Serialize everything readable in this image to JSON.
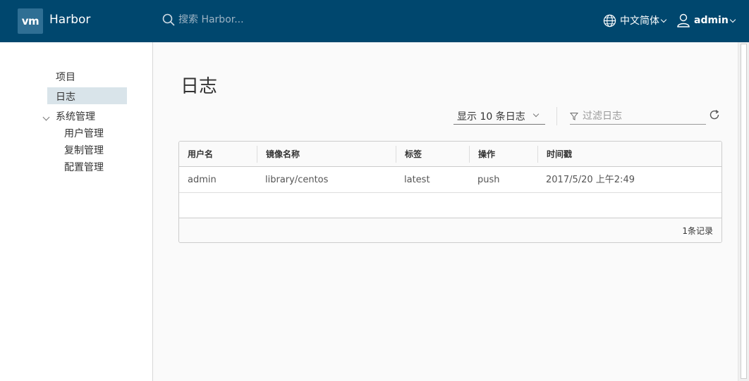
{
  "header": {
    "logo": "vm",
    "brand": "Harbor",
    "search_placeholder": "搜索 Harbor...",
    "language": "中文简体",
    "user": "admin"
  },
  "sidebar": {
    "items": [
      {
        "label": "项目"
      },
      {
        "label": "日志",
        "active": true
      },
      {
        "label": "系统管理"
      },
      {
        "label": "用户管理"
      },
      {
        "label": "复制管理"
      },
      {
        "label": "配置管理"
      }
    ]
  },
  "main": {
    "title": "日志",
    "page_size_select": "显示 10 条日志",
    "filter_placeholder": "过滤日志",
    "table": {
      "columns": [
        "用户名",
        "镜像名称",
        "标签",
        "操作",
        "时间戳"
      ],
      "rows": [
        [
          "admin",
          "library/centos",
          "latest",
          "push",
          "2017/5/20 上午2:49"
        ]
      ],
      "footer": "1条记录"
    }
  },
  "colors": {
    "header_bg": "#00476e",
    "active_nav_bg": "#d9e4ea"
  }
}
